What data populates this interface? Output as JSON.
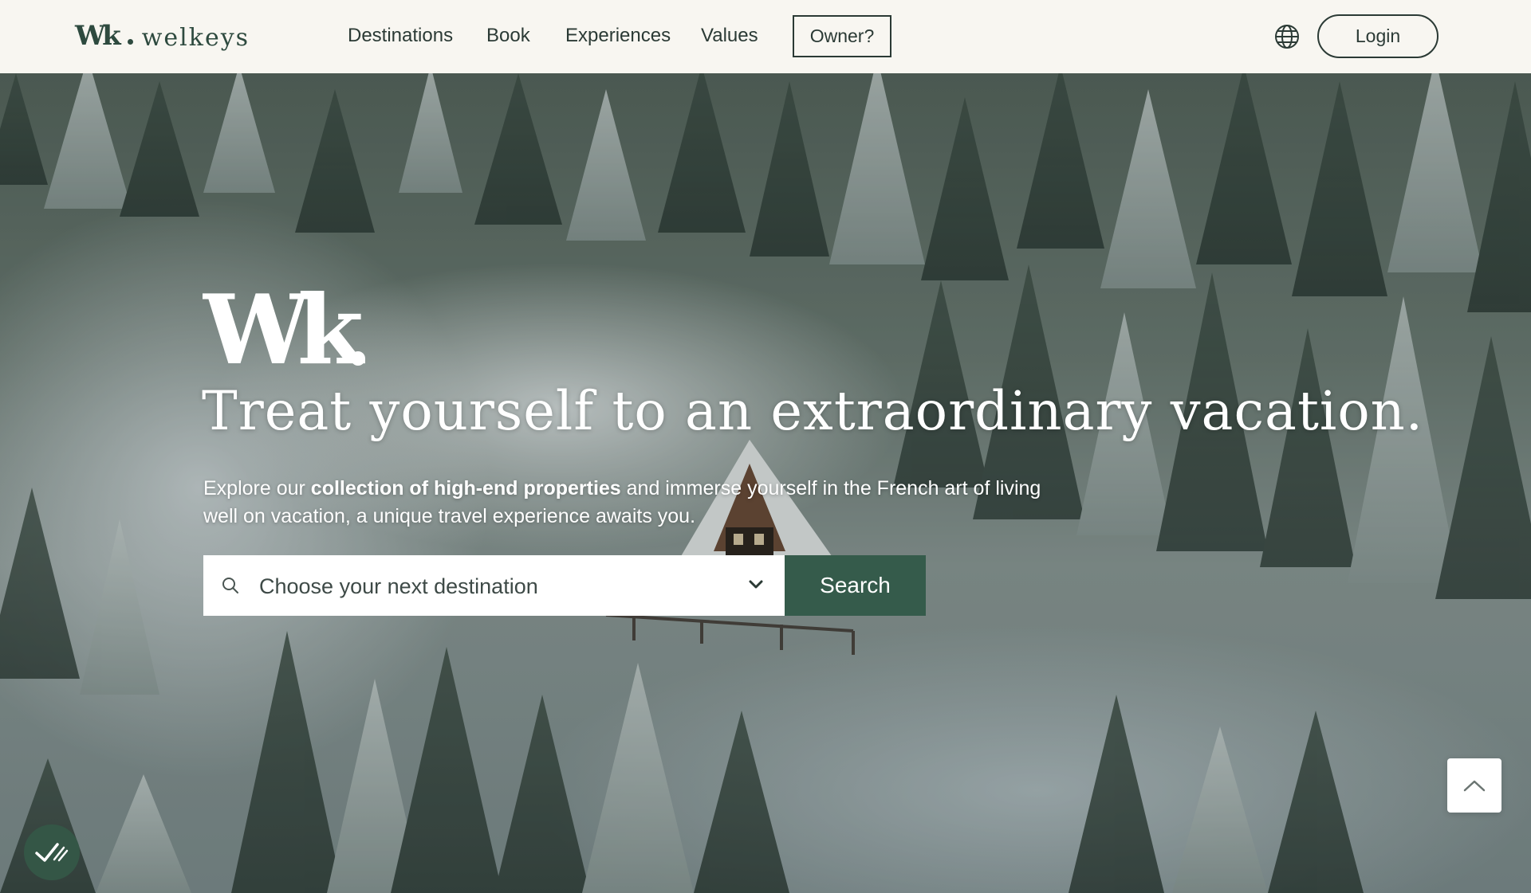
{
  "brand": {
    "mark": "Wk",
    "name": "welkeys"
  },
  "nav": {
    "items": [
      {
        "label": "Destinations"
      },
      {
        "label": "Book"
      },
      {
        "label": "Experiences"
      },
      {
        "label": "Values"
      }
    ],
    "owner_label": "Owner?",
    "login_label": "Login",
    "language_icon": "globe-icon"
  },
  "hero": {
    "headline": "Treat yourself to an extraordinary vacation.",
    "intro_before": "Explore our ",
    "intro_bold": "collection of high-end properties",
    "intro_after": " and immerse yourself in the French art of living well on vacation, a unique travel experience awaits you.",
    "search": {
      "placeholder": "Choose your next destination",
      "button_label": "Search"
    }
  },
  "icons": {
    "search": "search-icon",
    "dropdown": "chevron-down-icon",
    "scroll_top": "chevron-up-icon",
    "cookie": "cookie-consent-icon"
  },
  "colors": {
    "header_bg": "#f8f6f1",
    "brand_green": "#355b4b",
    "text_dark": "#2b3a35",
    "white": "#ffffff"
  }
}
